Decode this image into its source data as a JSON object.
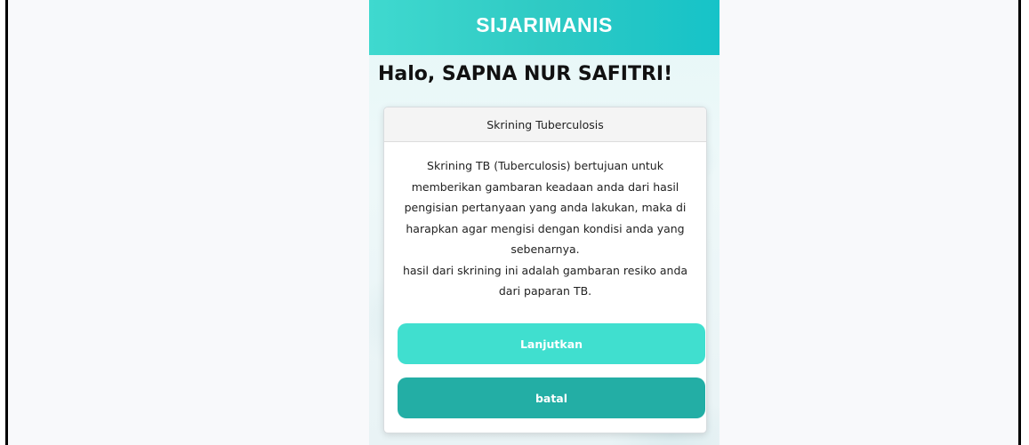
{
  "header": {
    "title": "SIJARIMANIS"
  },
  "greeting": "Halo, SAPNA NUR SAFITRI!",
  "card": {
    "title": "Skrining Tuberculosis",
    "description": "Skrining TB (Tuberculosis) bertujuan untuk memberikan gambaran keadaan anda dari hasil pengisian pertanyaan yang anda lakukan, maka di harapkan agar mengisi dengan kondisi anda yang sebenarnya.",
    "note": "hasil dari skrining ini adalah gambaran resiko anda dari paparan TB."
  },
  "buttons": {
    "continue_label": "Lanjutkan",
    "cancel_label": "batal"
  },
  "colors": {
    "header_start": "#3fd9cf",
    "header_end": "#16c3c8",
    "continue_button": "#40dfcf",
    "cancel_button": "#23aea5"
  }
}
